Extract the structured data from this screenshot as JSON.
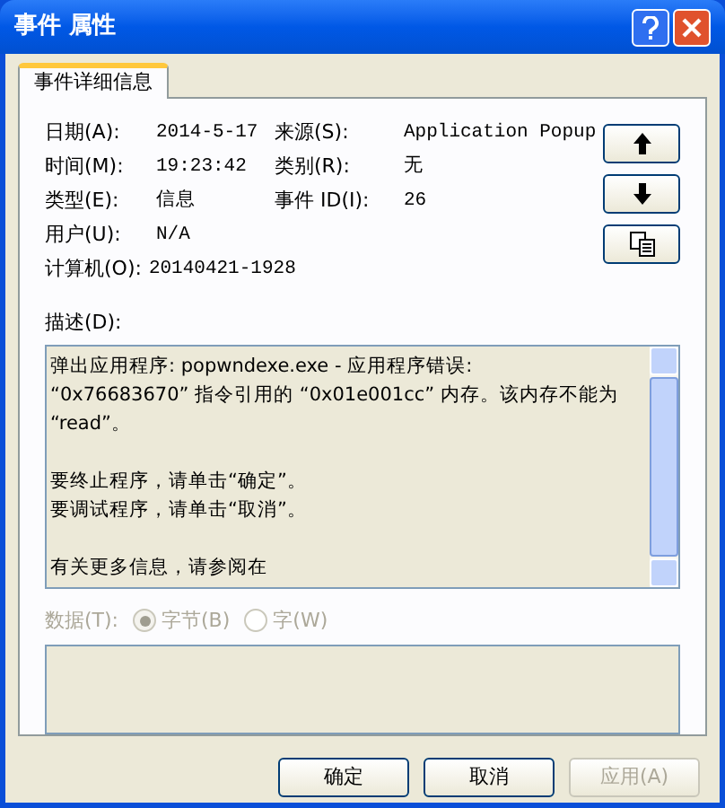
{
  "window": {
    "title": "事件 属性"
  },
  "tabs": [
    {
      "label": "事件详细信息",
      "selected": true
    }
  ],
  "fields": [
    {
      "label": "日期(A):",
      "value": "2014-5-17"
    },
    {
      "label": "来源(S):",
      "value": "Application Popup"
    },
    {
      "label": "时间(M):",
      "value": "19:23:42"
    },
    {
      "label": "类别(R):",
      "value": "无"
    },
    {
      "label": "类型(E):",
      "value": "信息"
    },
    {
      "label": "事件 ID(I):",
      "value": "26"
    },
    {
      "label": "用户(U):",
      "value": "N/A"
    }
  ],
  "computer": {
    "label": "计算机(O):",
    "value": "20140421-1928"
  },
  "side_buttons": [
    {
      "kind": "up"
    },
    {
      "kind": "down"
    },
    {
      "kind": "copy"
    }
  ],
  "description": {
    "label": "描述(D):",
    "paragraphs": [
      [
        "弹出应用程序: popwndexe.exe - 应用程序错误:",
        "“0x76683670” 指令引用的 “0x01e001cc” 内存。该内存不能为",
        "“read”。"
      ],
      [
        "要终止程序，请单击“确定”。",
        "要调试程序，请单击“取消”。"
      ],
      [
        "有关更多信息，请参阅在"
      ]
    ]
  },
  "data": {
    "label": "数据(T):",
    "disabled": true,
    "options": [
      {
        "label": "字节(B)",
        "selected": true
      },
      {
        "label": "字(W)",
        "selected": false
      }
    ]
  },
  "buttons": [
    {
      "label": "确定",
      "disabled": false
    },
    {
      "label": "取消",
      "disabled": false
    },
    {
      "label": "应用(A)",
      "disabled": true
    }
  ]
}
